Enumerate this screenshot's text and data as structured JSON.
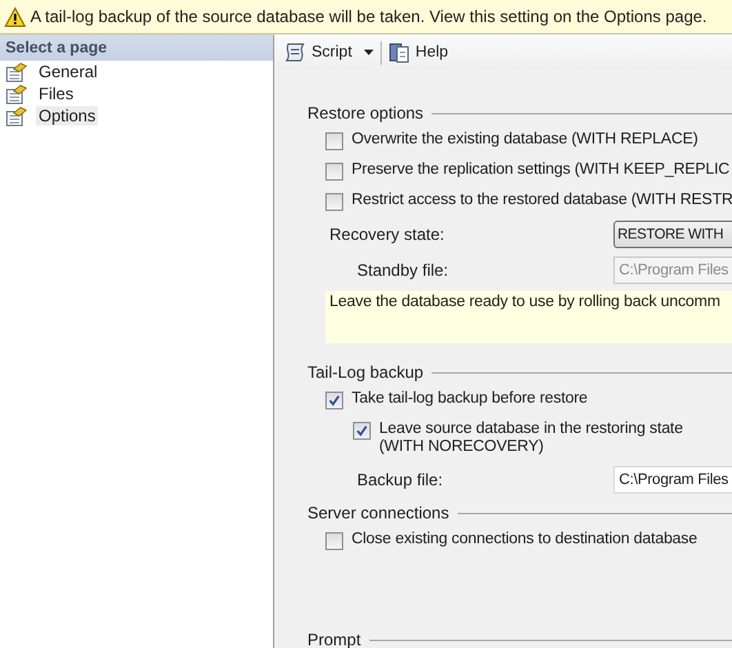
{
  "banner": {
    "text": "A tail-log backup of the source database will be taken. View this setting on the Options page."
  },
  "sidebar": {
    "title": "Select a page",
    "items": [
      {
        "label": "General",
        "selected": false
      },
      {
        "label": "Files",
        "selected": false
      },
      {
        "label": "Options",
        "selected": true
      }
    ]
  },
  "toolbar": [
    {
      "kind": "script",
      "label": "Script"
    },
    {
      "kind": "help",
      "label": "Help"
    }
  ],
  "sections": [
    {
      "title": "Restore options",
      "rows": [
        {
          "kind": "checkbox",
          "label": "Overwrite the existing database (WITH REPLACE)",
          "checked": false
        },
        {
          "kind": "checkbox",
          "label": "Preserve the replication settings (WITH KEEP_REPLIC",
          "checked": false
        },
        {
          "kind": "checkbox",
          "label": "Restrict access to the restored database (WITH RESTR",
          "checked": false
        },
        {
          "kind": "combo",
          "label": "Recovery state:",
          "value": "RESTORE WITH",
          "children": [
            {
              "kind": "field",
              "label": "Standby file:",
              "value": "C:\\Program Files",
              "disabled": true
            }
          ]
        },
        {
          "kind": "note",
          "text": "Leave the database ready to use by rolling back uncomm"
        }
      ]
    },
    {
      "title": "Tail-Log backup",
      "rows": [
        {
          "kind": "checkbox",
          "label": "Take tail-log backup before restore",
          "checked": true,
          "children": [
            {
              "kind": "checkbox",
              "label": "Leave source database in the restoring state (WITH NORECOVERY)",
              "checked": true
            },
            {
              "kind": "field",
              "label": "Backup file:",
              "value": "C:\\Program Files",
              "disabled": false
            }
          ]
        }
      ]
    },
    {
      "title": "Server connections",
      "rows": [
        {
          "kind": "checkbox",
          "label": "Close existing connections to destination database",
          "checked": false
        }
      ]
    },
    {
      "title": "Prompt"
    }
  ]
}
